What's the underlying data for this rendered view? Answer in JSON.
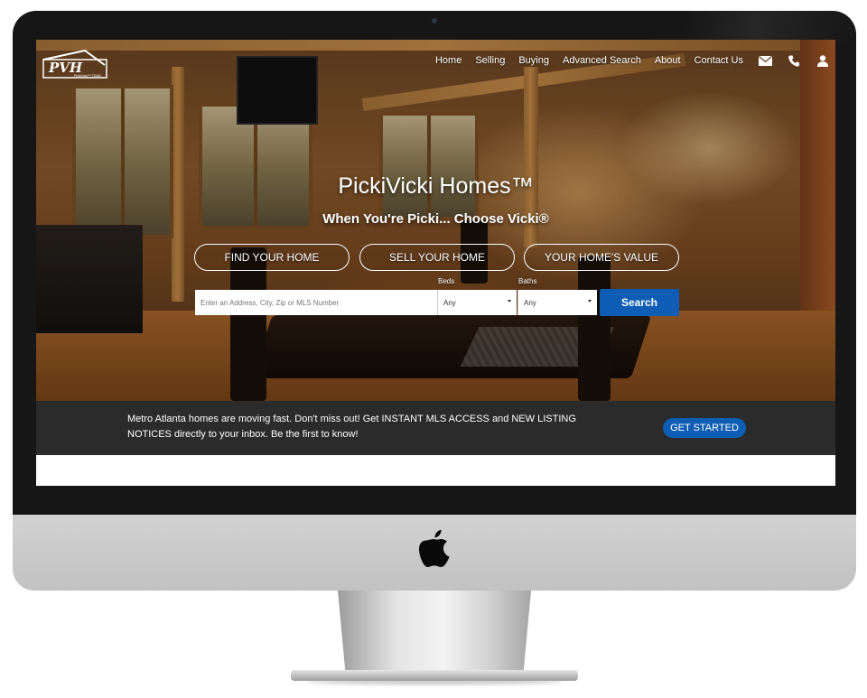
{
  "brand": {
    "logo_text": "PVH",
    "logo_subtext": "PickiVicki™ TEAM"
  },
  "nav": {
    "links": [
      {
        "label": "Home"
      },
      {
        "label": "Selling"
      },
      {
        "label": "Buying"
      },
      {
        "label": "Advanced Search"
      },
      {
        "label": "About"
      },
      {
        "label": "Contact Us"
      }
    ],
    "icons": [
      "envelope-icon",
      "phone-icon",
      "user-icon"
    ]
  },
  "hero": {
    "title": "PickiVicki Homes™",
    "subtitle": "When You're Picki... Choose Vicki®",
    "buttons": [
      {
        "label": "FIND YOUR HOME"
      },
      {
        "label": "SELL YOUR HOME"
      },
      {
        "label": "YOUR HOME'S VALUE"
      }
    ]
  },
  "search": {
    "placeholder": "Enter an Address, City, Zip or MLS Number",
    "beds_label": "Beds",
    "beds_value": "Any",
    "baths_label": "Baths",
    "baths_value": "Any",
    "button_label": "Search"
  },
  "banner": {
    "text": "Metro Atlanta homes are moving fast. Don't miss out! Get INSTANT MLS ACCESS and NEW LISTING NOTICES directly to your inbox. Be the first to know!",
    "cta_label": "GET STARTED"
  },
  "colors": {
    "accent": "#0d5db4",
    "banner_bg": "#2b2b2b"
  }
}
